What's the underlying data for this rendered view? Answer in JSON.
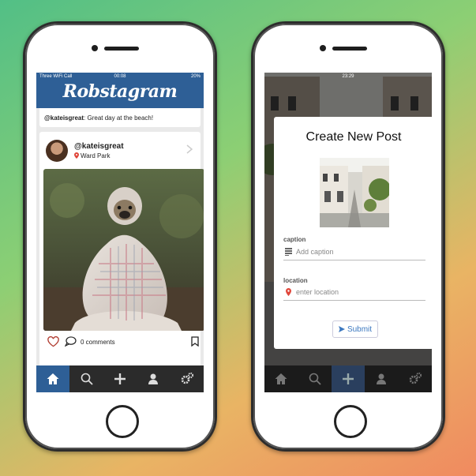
{
  "left_phone": {
    "status": {
      "carrier": "Three WiFi Call",
      "time": "00:08",
      "battery": "20%"
    },
    "app_title": "Robstagram",
    "previous_post": {
      "user": "@kateisgreat",
      "caption": ": Great day at the beach!"
    },
    "post": {
      "user": "@kateisgreat",
      "location": "Ward Park",
      "comments": "0 comments"
    },
    "tabs": [
      "home-icon",
      "search-icon",
      "plus-icon",
      "user-icon",
      "settings-icon"
    ],
    "active_tab": "home",
    "colors": {
      "brand": "#2e5f96",
      "tabbar": "#2b2b2b"
    }
  },
  "right_phone": {
    "status": {
      "time": "23:29"
    },
    "modal": {
      "title": "Create New Post",
      "caption_label": "caption",
      "caption_placeholder": "Add caption",
      "location_label": "location",
      "location_placeholder": "enter location",
      "submit_label": "Submit"
    },
    "tabs": [
      "home-icon",
      "search-icon",
      "plus-icon",
      "user-icon",
      "settings-icon"
    ],
    "active_tab": "add",
    "colors": {
      "accent": "#3c78c0",
      "pin": "#e0463a"
    }
  }
}
